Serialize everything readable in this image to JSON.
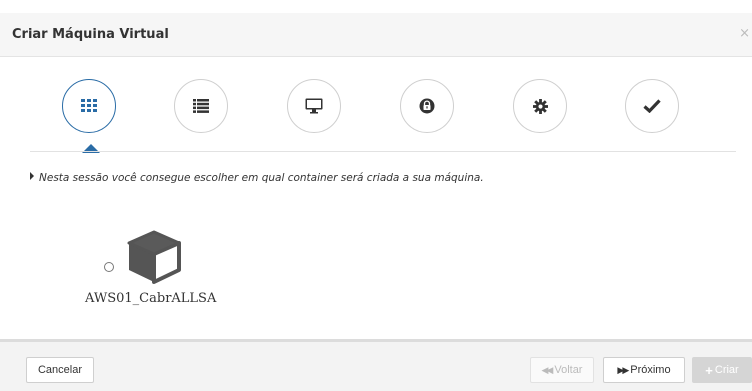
{
  "dialog": {
    "title": "Criar Máquina Virtual",
    "close_label": "×"
  },
  "wizard": {
    "steps": [
      {
        "name": "container",
        "icon": "grid-icon",
        "active": true
      },
      {
        "name": "list",
        "icon": "list-icon",
        "active": false
      },
      {
        "name": "monitor",
        "icon": "monitor-icon",
        "active": false
      },
      {
        "name": "lock",
        "icon": "lock-icon",
        "active": false
      },
      {
        "name": "settings",
        "icon": "gear-icon",
        "active": false
      },
      {
        "name": "confirm",
        "icon": "checkmark-icon",
        "active": false
      }
    ],
    "info_text": "Nesta sessão você consegue escolher em qual container será criada a sua máquina."
  },
  "containers": [
    {
      "name": "AWS01_CabrALLSA",
      "icon": "cube-icon",
      "selected": false
    }
  ],
  "footer": {
    "cancel_label": "Cancelar",
    "back_label": "Voltar",
    "next_label": "Próximo",
    "create_label": "Criar"
  },
  "colors": {
    "accent": "#2a6ca6",
    "icon_dark": "#333333",
    "cube": "#555555",
    "header_bg": "#f6f6f6",
    "footer_bg": "#f3f3f3"
  }
}
